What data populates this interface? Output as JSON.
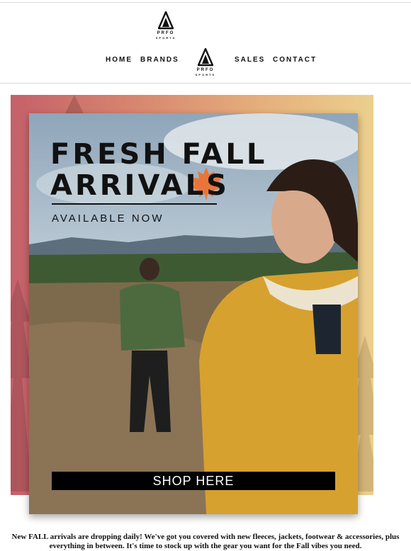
{
  "brand": {
    "name": "PRFO",
    "tagline": "SPORTS"
  },
  "nav": {
    "items": [
      {
        "label": "HOME"
      },
      {
        "label": "BRANDS"
      },
      {
        "label": "SALES"
      },
      {
        "label": "CONTACT"
      }
    ]
  },
  "hero": {
    "title_line1": "FRESH FALL",
    "title_line2": "ARRIVALS",
    "subtitle": "AVAILABLE NOW",
    "cta_label": "SHOP HERE",
    "leaf_icon": "maple-leaf-icon",
    "colors": {
      "leaf": "#e8763a",
      "fleece": "#d6a12e",
      "button": "#000000"
    }
  },
  "body": {
    "text": "New FALL arrivals are dropping daily! We've got you covered with new fleeces, jackets, footwear & accessories, plus everything in between. It's time to stock up with the gear you want for the Fall vibes you need."
  }
}
